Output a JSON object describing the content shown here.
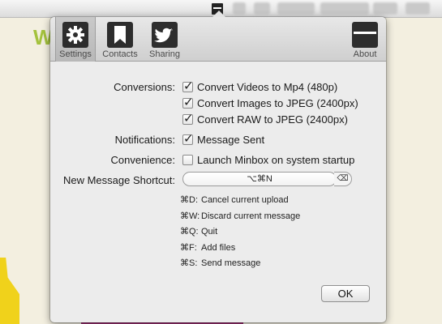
{
  "background": {
    "logo_text": "W"
  },
  "toolbar": {
    "settings_label": "Settings",
    "contacts_label": "Contacts",
    "sharing_label": "Sharing",
    "about_label": "About"
  },
  "conversions": {
    "label": "Conversions:",
    "items": [
      {
        "label": "Convert Videos to Mp4 (480p)",
        "checked": true
      },
      {
        "label": "Convert Images to JPEG (2400px)",
        "checked": true
      },
      {
        "label": "Convert RAW to JPEG (2400px)",
        "checked": true
      }
    ]
  },
  "notifications": {
    "label": "Notifications:",
    "item_label": "Message Sent",
    "checked": true
  },
  "convenience": {
    "label": "Convenience:",
    "item_label": "Launch Minbox on system startup",
    "checked": false
  },
  "shortcut": {
    "label": "New Message Shortcut:",
    "value": "⌥⌘N",
    "clear_glyph": "⌫"
  },
  "hints": [
    {
      "key": "⌘D:",
      "text": "Cancel current upload"
    },
    {
      "key": "⌘W:",
      "text": "Discard current message"
    },
    {
      "key": "⌘Q:",
      "text": "Quit"
    },
    {
      "key": "⌘F:",
      "text": "Add files"
    },
    {
      "key": "⌘S:",
      "text": "Send message"
    }
  ],
  "ok_label": "OK"
}
